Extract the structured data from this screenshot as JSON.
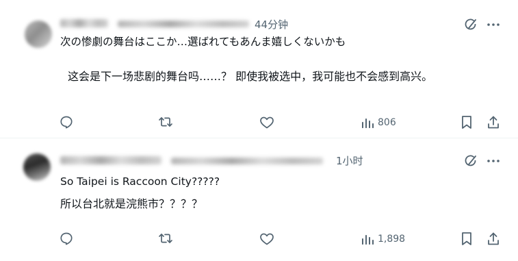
{
  "posts": [
    {
      "time": "44分钟",
      "text_original": "次の惨劇の舞台はここか…選ばれてもあんま嬉しくないかも",
      "text_translation": "这会是下一场悲剧的舞台吗……？ 即使我被选中，我可能也不会感到高兴。",
      "views": "806",
      "icons": [
        "grok-icon",
        "more-icon",
        "reply-icon",
        "repost-icon",
        "like-icon",
        "views-icon",
        "bookmark-icon",
        "share-icon"
      ]
    },
    {
      "time": "1小时",
      "text_original": "So Taipei is Raccoon City?????",
      "text_translation": "所以台北就是浣熊市？？？？",
      "views": "1,898",
      "icons": [
        "grok-icon",
        "more-icon",
        "reply-icon",
        "repost-icon",
        "like-icon",
        "views-icon",
        "bookmark-icon",
        "share-icon"
      ]
    }
  ],
  "colors": {
    "text_primary": "#0f1419",
    "text_secondary": "#536471",
    "divider": "#eff3f4",
    "background": "#ffffff"
  }
}
